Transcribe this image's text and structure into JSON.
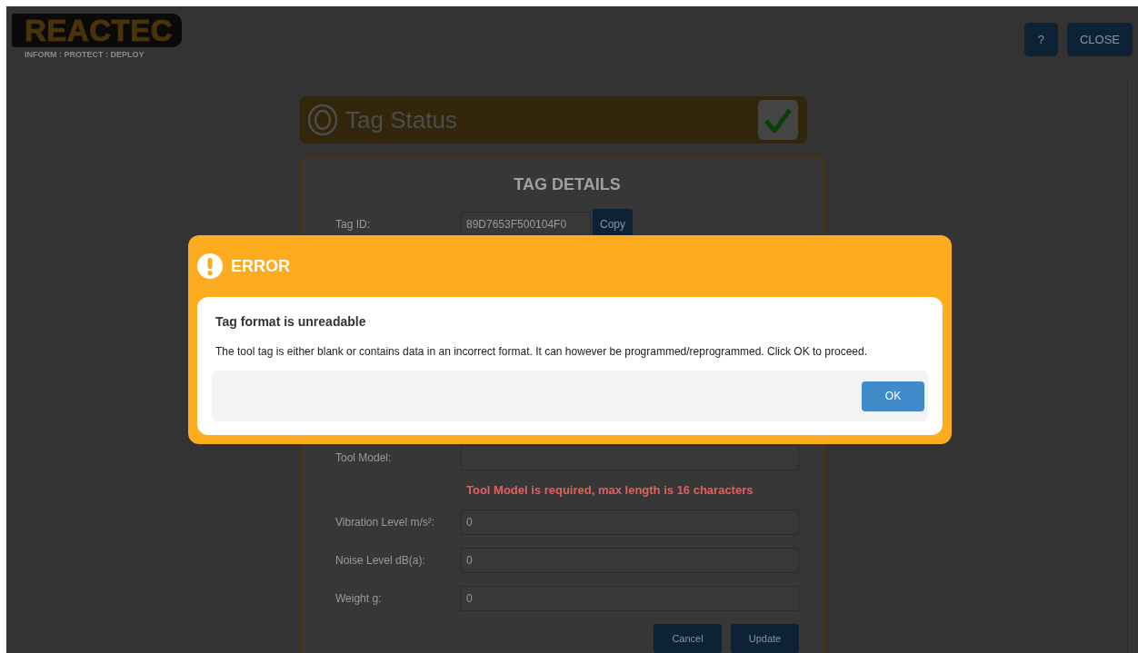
{
  "header": {
    "logo_text": "REACTEC",
    "tagline": "INFORM : PROTECT : DEPLOY",
    "buttons": [
      {
        "label": "?"
      },
      {
        "label": "CLOSE"
      }
    ]
  },
  "tag_status": {
    "title": "Tag Status",
    "verified": true
  },
  "tag_details": {
    "heading": "TAG DETAILS",
    "tag_id": {
      "label": "Tag ID:",
      "value": "89D7653F500104F0",
      "button": "Copy"
    },
    "fields": [
      {
        "label": "Tool Model:",
        "error": "Tool Model is required, max length is 16 characters"
      },
      {
        "label": "Vibration Level m/s²:",
        "value": "0"
      },
      {
        "label": "Noise Level dB(a):",
        "value": "0"
      },
      {
        "label": "Weight g:",
        "value": "0"
      }
    ],
    "buttons": [
      {
        "label": "Cancel"
      },
      {
        "label": "Update"
      }
    ]
  },
  "modal": {
    "title": "ERROR",
    "heading": "Tag format is unreadable",
    "message": "The tool tag is either blank or contains data in an incorrect format. It can however be programmed/reprogrammed. Click OK to proceed.",
    "buttons": [
      {
        "label": "OK"
      }
    ]
  }
}
